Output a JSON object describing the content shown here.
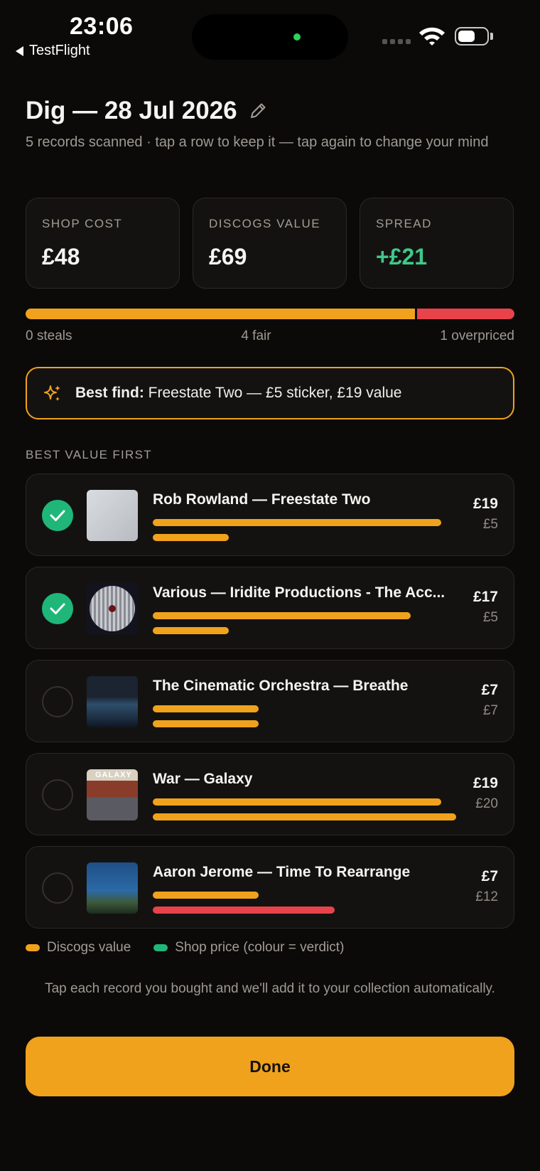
{
  "status_bar": {
    "time": "23:06",
    "back_app": "TestFlight"
  },
  "header": {
    "title": "Dig — 28 Jul 2026",
    "subtitle": "5 records scanned · tap a row to keep it — tap again to change your mind"
  },
  "stats": [
    {
      "label": "SHOP COST",
      "value": "£48"
    },
    {
      "label": "DISCOGS VALUE",
      "value": "£69"
    },
    {
      "label": "SPREAD",
      "value": "+£21"
    }
  ],
  "verdict": {
    "steals": "0 steals",
    "fair": "4 fair",
    "overpriced": "1 overpriced",
    "fair_count": 4,
    "overpriced_count": 1
  },
  "best_find": {
    "label": "Best find:",
    "text": "Freestate Two — £5 sticker, £19 value"
  },
  "section_label": "BEST VALUE FIRST",
  "records": [
    {
      "title": "Rob Rowland — Freestate Two",
      "value": "£19",
      "price": "£5",
      "value_num": 19,
      "price_num": 5,
      "kept": true,
      "verdict": "fair"
    },
    {
      "title": "Various — Iridite Productions - The Acc...",
      "value": "£17",
      "price": "£5",
      "value_num": 17,
      "price_num": 5,
      "kept": true,
      "verdict": "fair"
    },
    {
      "title": "The Cinematic Orchestra — Breathe",
      "value": "£7",
      "price": "£7",
      "value_num": 7,
      "price_num": 7,
      "kept": false,
      "verdict": "fair"
    },
    {
      "title": "War — Galaxy",
      "value": "£19",
      "price": "£20",
      "value_num": 19,
      "price_num": 20,
      "kept": false,
      "verdict": "fair"
    },
    {
      "title": "Aaron Jerome — Time To Rearrange",
      "value": "£7",
      "price": "£12",
      "value_num": 7,
      "price_num": 12,
      "kept": false,
      "verdict": "overpriced"
    }
  ],
  "cover_texts": {
    "galaxy": "GALAXY"
  },
  "legend": {
    "discogs": "Discogs value",
    "shop": "Shop price (colour = verdict)"
  },
  "footnote": "Tap each record you bought and we'll add it to your collection automatically.",
  "done_label": "Done",
  "colors": {
    "accent": "#f1a21c",
    "fair": "#f1a21c",
    "overpriced": "#e8434a",
    "steal": "#1fb67a",
    "positive": "#3fc98a"
  }
}
